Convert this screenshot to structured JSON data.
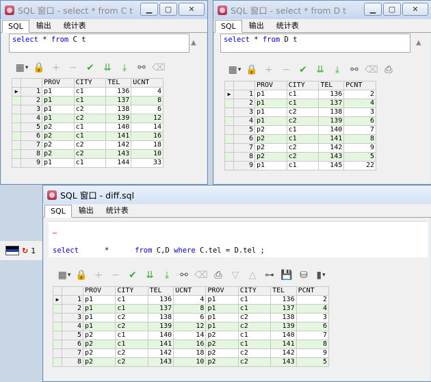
{
  "win1": {
    "title": "SQL 窗口 - select * from C t",
    "tabs": [
      "SQL",
      "输出",
      "统计表"
    ],
    "sql": {
      "kw1": "select",
      "star": "*",
      "kw2": "from",
      "rest": "C t"
    },
    "columns": [
      "PROV",
      "CITY",
      "TEL",
      "UCNT"
    ],
    "rows": [
      [
        "1",
        "p1",
        "c1",
        "136",
        "4"
      ],
      [
        "2",
        "p1",
        "c1",
        "137",
        "8"
      ],
      [
        "3",
        "p1",
        "c2",
        "138",
        "6"
      ],
      [
        "4",
        "p1",
        "c2",
        "139",
        "12"
      ],
      [
        "5",
        "p2",
        "c1",
        "140",
        "14"
      ],
      [
        "6",
        "p2",
        "c1",
        "141",
        "16"
      ],
      [
        "7",
        "p2",
        "c2",
        "142",
        "18"
      ],
      [
        "8",
        "p2",
        "c2",
        "143",
        "10"
      ],
      [
        "9",
        "p1",
        "c1",
        "144",
        "33"
      ]
    ]
  },
  "win2": {
    "title": "SQL 窗口 - select * from D t",
    "tabs": [
      "SQL",
      "输出",
      "统计表"
    ],
    "sql": {
      "kw1": "select",
      "star": "*",
      "kw2": "from",
      "rest": "D t"
    },
    "columns": [
      "PROV",
      "CITY",
      "TEL",
      "PCNT"
    ],
    "rows": [
      [
        "1",
        "p1",
        "c1",
        "136",
        "2"
      ],
      [
        "2",
        "p1",
        "c1",
        "137",
        "4"
      ],
      [
        "3",
        "p1",
        "c2",
        "138",
        "3"
      ],
      [
        "4",
        "p1",
        "c2",
        "139",
        "6"
      ],
      [
        "5",
        "p2",
        "c1",
        "140",
        "7"
      ],
      [
        "6",
        "p2",
        "c1",
        "141",
        "8"
      ],
      [
        "7",
        "p2",
        "c2",
        "142",
        "9"
      ],
      [
        "8",
        "p2",
        "c2",
        "143",
        "5"
      ],
      [
        "9",
        "p1",
        "c1",
        "145",
        "22"
      ]
    ]
  },
  "win3": {
    "title": "SQL 窗口 - diff.sql",
    "tabs": [
      "SQL",
      "输出",
      "统计表"
    ],
    "sql": {
      "marker": "—",
      "kw1": "select",
      "star": "*",
      "kw2": "from",
      "tables": "C,D",
      "kw3": "where",
      "cond": "C.tel = D.tel ;"
    },
    "columns": [
      "PROV",
      "CITY",
      "TEL",
      "UCNT",
      "PROV",
      "CITY",
      "TEL",
      "PCNT"
    ],
    "rows": [
      [
        "1",
        "p1",
        "c1",
        "136",
        "4",
        "p1",
        "c1",
        "136",
        "2"
      ],
      [
        "2",
        "p1",
        "c1",
        "137",
        "8",
        "p1",
        "c1",
        "137",
        "4"
      ],
      [
        "3",
        "p1",
        "c2",
        "138",
        "6",
        "p1",
        "c2",
        "138",
        "3"
      ],
      [
        "4",
        "p1",
        "c2",
        "139",
        "12",
        "p1",
        "c2",
        "139",
        "6"
      ],
      [
        "5",
        "p2",
        "c1",
        "140",
        "14",
        "p2",
        "c1",
        "140",
        "7"
      ],
      [
        "6",
        "p2",
        "c1",
        "141",
        "16",
        "p2",
        "c1",
        "141",
        "8"
      ],
      [
        "7",
        "p2",
        "c2",
        "142",
        "18",
        "p2",
        "c2",
        "142",
        "9"
      ],
      [
        "8",
        "p2",
        "c2",
        "143",
        "10",
        "p2",
        "c2",
        "143",
        "5"
      ]
    ]
  },
  "status": {
    "text": "1"
  },
  "icons": {
    "grid": "grid-icon",
    "lock": "lock-icon",
    "add": "plus-icon",
    "remove": "minus-icon",
    "post": "check-icon",
    "next": "double-down-icon",
    "last": "double-down-last-icon",
    "find": "binoculars-icon",
    "clear": "eraser-icon",
    "save": "save-icon"
  }
}
